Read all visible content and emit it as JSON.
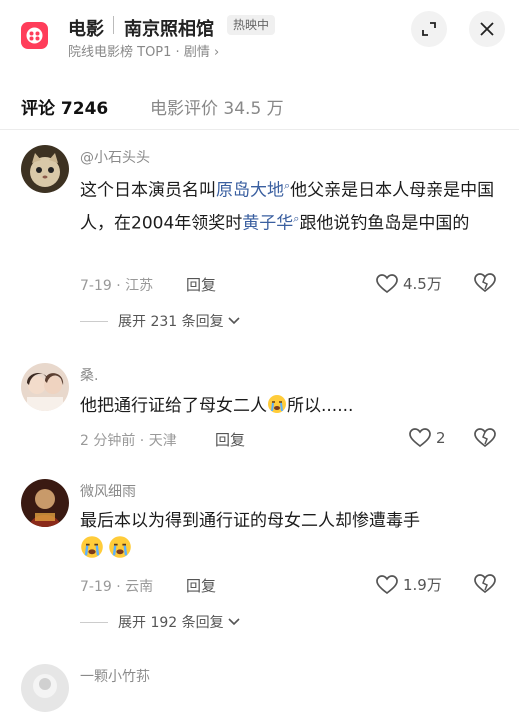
{
  "header": {
    "category": "电影",
    "movie_title": "南京照相馆",
    "status_badge": "热映中",
    "subtitle": "院线电影榜 TOP1 · 剧情 ›"
  },
  "tabs": [
    {
      "label": "评论 7246"
    },
    {
      "label": "电影评价 34.5 万"
    }
  ],
  "comments": [
    {
      "username": "@小石头头",
      "text_parts": [
        "这个日本演员名叫",
        "原岛大地",
        "他父亲是日本人母亲是中国人，在2004年领奖时",
        "黄子华",
        "跟他说钓鱼岛是中国的"
      ],
      "meta": "7-19 · 江苏",
      "reply_label": "回复",
      "likes": "4.5万",
      "expand_label": "展开 231 条回复"
    },
    {
      "username": "桑.",
      "text_parts": [
        "他把通行证给了母女二人",
        "所以......"
      ],
      "meta": "2 分钟前 · 天津",
      "reply_label": "回复",
      "likes": "2"
    },
    {
      "username": "微风细雨",
      "text_parts": [
        "最后本以为得到通行证的母女二人却惨遭毒手"
      ],
      "meta": "7-19 · 云南",
      "reply_label": "回复",
      "likes": "1.9万",
      "expand_label": "展开 192 条回复"
    },
    {
      "username": "一颗小竹荪"
    }
  ],
  "colors": {
    "brand_red": "#ff3d5a",
    "mention_blue": "#3a5fa0"
  }
}
